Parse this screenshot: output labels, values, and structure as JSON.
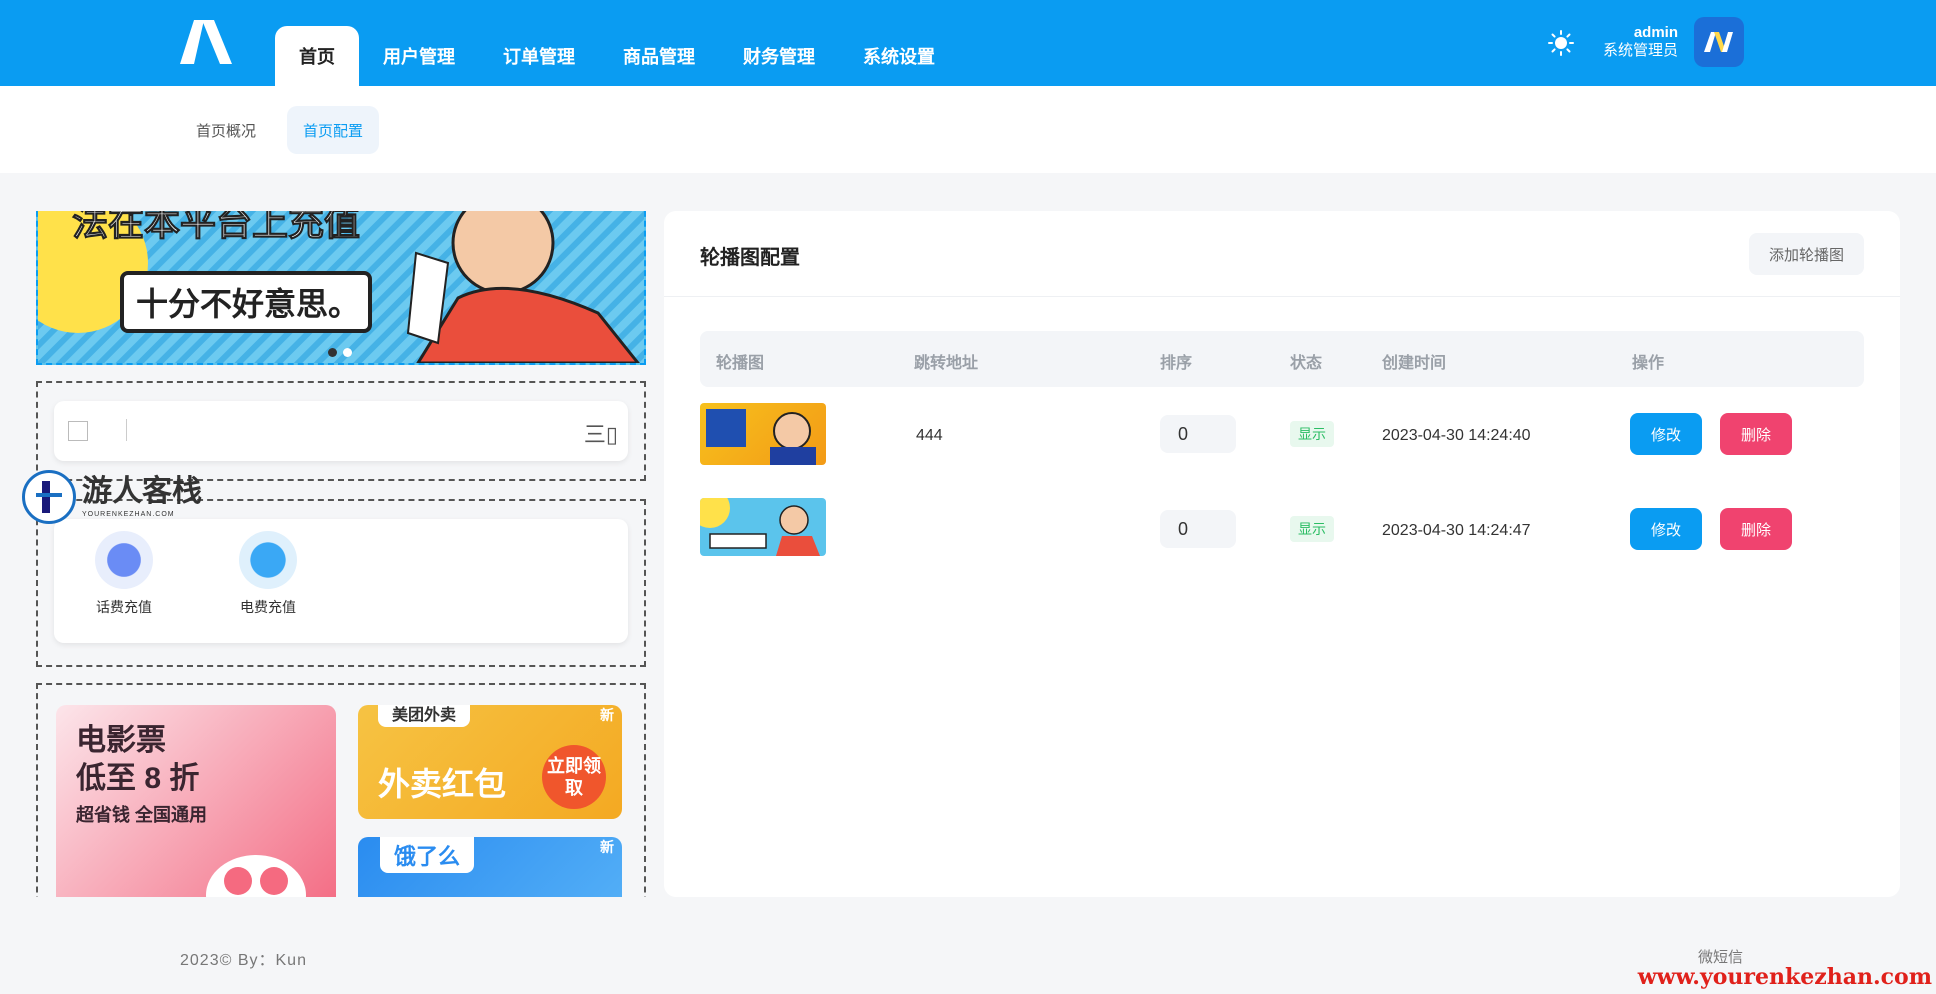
{
  "header": {
    "nav": [
      "首页",
      "用户管理",
      "订单管理",
      "商品管理",
      "财务管理",
      "系统设置"
    ],
    "user_name": "admin",
    "user_role": "系统管理员"
  },
  "subnav": [
    "首页概况",
    "首页配置"
  ],
  "preview": {
    "banner_line1": "法在本平台上充值",
    "banner_line2": "十分不好意思。",
    "search_menu": "三▯",
    "icons": [
      "话费充值",
      "电费充值"
    ],
    "ads": {
      "movie_title": "电影票",
      "movie_line2": "低至 8 折",
      "movie_line3": "超省钱 全国通用",
      "food_brand": "美团外卖",
      "food_title": "外卖红包",
      "food_cta": "立即领取",
      "ele_brand": "饿了么",
      "new": "新"
    },
    "watermark": {
      "name": "游人客栈",
      "sub": "YOURENKEZHAN.COM"
    }
  },
  "panel": {
    "title": "轮播图配置",
    "add_button": "添加轮播图",
    "columns": [
      "轮播图",
      "跳转地址",
      "排序",
      "状态",
      "创建时间",
      "操作"
    ],
    "rows": [
      {
        "link": "444",
        "sort": "0",
        "status": "显示",
        "created": "2023-04-30 14:24:40",
        "edit": "修改",
        "delete": "删除"
      },
      {
        "link": "",
        "sort": "0",
        "status": "显示",
        "created": "2023-04-30 14:24:47",
        "edit": "修改",
        "delete": "删除"
      }
    ]
  },
  "footer": {
    "copyright": "2023©  By：Kun",
    "right": "微短信",
    "site": "www.yourenkezhan.com"
  },
  "colors": {
    "primary": "#0a9cf2",
    "danger": "#f0436f",
    "success": "#2bbd64"
  }
}
